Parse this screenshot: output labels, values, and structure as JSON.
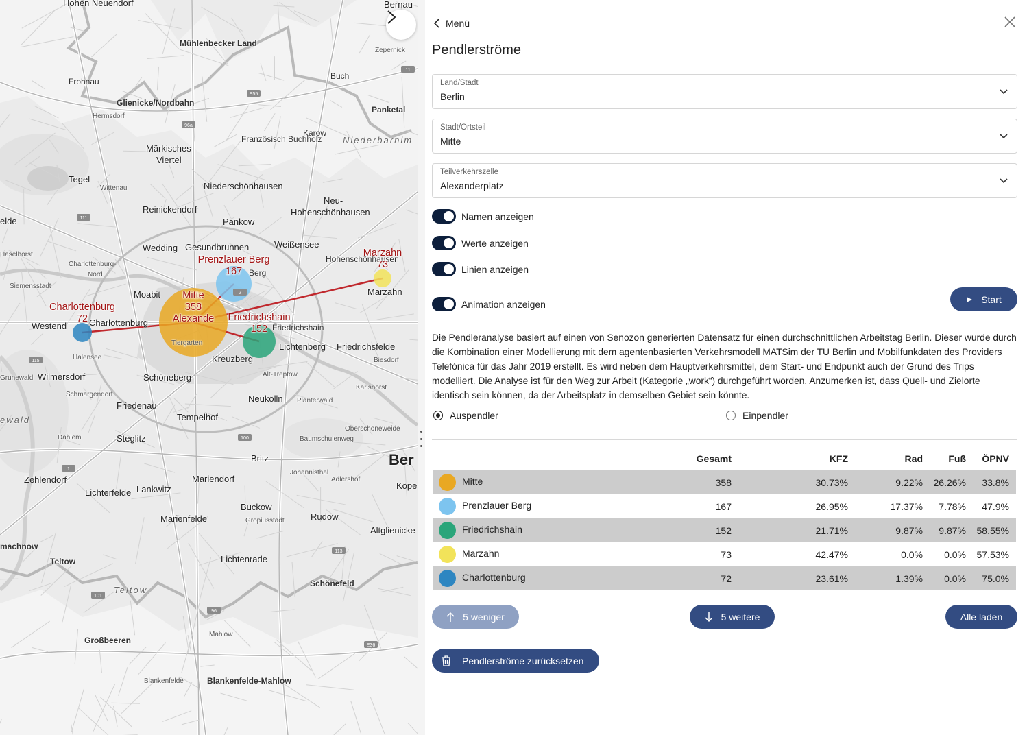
{
  "map": {
    "labels": [
      {
        "text": "Hohen Neuendorf",
        "cls": "big"
      },
      {
        "text": "Bernau",
        "cls": "big"
      },
      {
        "text": "Mühlenbecker Land",
        "cls": "bold"
      },
      {
        "text": "Zepernick",
        "cls": "tiny"
      },
      {
        "text": "Frohnau",
        "cls": ""
      },
      {
        "text": "Buch",
        "cls": ""
      },
      {
        "text": "Glienicke/Nordbahn",
        "cls": "bold"
      },
      {
        "text": "Panketal",
        "cls": "bold"
      },
      {
        "text": "Hermsdorf",
        "cls": "tiny"
      },
      {
        "text": "Französisch Buchholz",
        "cls": ""
      },
      {
        "text": "Karow",
        "cls": ""
      },
      {
        "text": "Niederbarnim",
        "cls": "italic"
      },
      {
        "text": "Märkisches",
        "cls": "big"
      },
      {
        "text": "Viertel",
        "cls": "big"
      },
      {
        "text": "Tegel",
        "cls": "big"
      },
      {
        "text": "Wittenau",
        "cls": "tiny"
      },
      {
        "text": "Niederschönhausen",
        "cls": "big"
      },
      {
        "text": "Reinickendorf",
        "cls": "big"
      },
      {
        "text": "Neu-",
        "cls": "big"
      },
      {
        "text": "Hohenschönhausen",
        "cls": "big"
      },
      {
        "text": "Pankow",
        "cls": "big"
      },
      {
        "text": "elde",
        "cls": "big"
      },
      {
        "text": "Wedding",
        "cls": "big"
      },
      {
        "text": "Gesundbrunnen",
        "cls": "big"
      },
      {
        "text": "Weißensee",
        "cls": "big"
      },
      {
        "text": "Haselhorst",
        "cls": "tiny"
      },
      {
        "text": "Charlottenburg-",
        "cls": "tiny"
      },
      {
        "text": "Nord",
        "cls": "tiny"
      },
      {
        "text": "Hohenschönhausen",
        "cls": ""
      },
      {
        "text": "Siemensstadt",
        "cls": "tiny"
      },
      {
        "text": "Moabit",
        "cls": "big"
      },
      {
        "text": "Berg",
        "cls": ""
      },
      {
        "text": "Marzahn",
        "cls": "big"
      },
      {
        "text": "Westend",
        "cls": "big"
      },
      {
        "text": "Charlottenburg",
        "cls": "big"
      },
      {
        "text": "Friedrichshain",
        "cls": ""
      },
      {
        "text": "Tiergarten",
        "cls": "tiny"
      },
      {
        "text": "Lichtenberg",
        "cls": "big"
      },
      {
        "text": "Friedrichsfelde",
        "cls": "big"
      },
      {
        "text": "Halensee",
        "cls": "tiny"
      },
      {
        "text": "Kreuzberg",
        "cls": "big"
      },
      {
        "text": "Biesdorf",
        "cls": "tiny"
      },
      {
        "text": "Grunewald",
        "cls": "tiny"
      },
      {
        "text": "Wilmersdorf",
        "cls": "big"
      },
      {
        "text": "Schöneberg",
        "cls": "big"
      },
      {
        "text": "Alt-Treptow",
        "cls": "tiny"
      },
      {
        "text": "Karlshorst",
        "cls": "tiny"
      },
      {
        "text": "Schmargendorf",
        "cls": "tiny"
      },
      {
        "text": "Neukölln",
        "cls": "big"
      },
      {
        "text": "Plänterwald",
        "cls": "tiny"
      },
      {
        "text": "Friedenau",
        "cls": "big"
      },
      {
        "text": "ewald",
        "cls": "italic"
      },
      {
        "text": "Tempelhof",
        "cls": "big"
      },
      {
        "text": "Oberschöneweide",
        "cls": "tiny"
      },
      {
        "text": "Dahlem",
        "cls": "tiny"
      },
      {
        "text": "Steglitz",
        "cls": "big"
      },
      {
        "text": "Baumschulenweg",
        "cls": "tiny"
      },
      {
        "text": "Ber",
        "cls": "huge"
      },
      {
        "text": "Britz",
        "cls": "big"
      },
      {
        "text": "Johannisthal",
        "cls": "tiny"
      },
      {
        "text": "Zehlendorf",
        "cls": "big"
      },
      {
        "text": "Mariendorf",
        "cls": "big"
      },
      {
        "text": "Adlershof",
        "cls": "tiny"
      },
      {
        "text": "Köpe",
        "cls": "big"
      },
      {
        "text": "Lankwitz",
        "cls": "big"
      },
      {
        "text": "Lichterfelde",
        "cls": "big"
      },
      {
        "text": "Buckow",
        "cls": "big"
      },
      {
        "text": "Marienfelde",
        "cls": "big"
      },
      {
        "text": "Gropiusstadt",
        "cls": "tiny"
      },
      {
        "text": "Rudow",
        "cls": "big"
      },
      {
        "text": "Altglienicke",
        "cls": "big"
      },
      {
        "text": "machnow",
        "cls": "bold"
      },
      {
        "text": "Teltow",
        "cls": "bold"
      },
      {
        "text": "Lichtenrade",
        "cls": "big"
      },
      {
        "text": "Schönefeld",
        "cls": "bold"
      },
      {
        "text": "Teltow",
        "cls": "italic"
      },
      {
        "text": "Mahlow",
        "cls": "tiny"
      },
      {
        "text": "Großbeeren",
        "cls": "bold"
      },
      {
        "text": "Blankenfelde",
        "cls": "tiny"
      },
      {
        "text": "Blankenfelde-Mahlow",
        "cls": "bold"
      }
    ],
    "road_numbers": [
      "E55",
      "96a",
      "11",
      "111",
      "115",
      "100",
      "96",
      "101",
      "113",
      "E36",
      "1",
      "2"
    ],
    "flows": [
      {
        "name": "Mitte",
        "value": 358,
        "extra": "Alexande",
        "color": "#e9a823"
      },
      {
        "name": "Prenzlauer Berg",
        "value": 167,
        "color": "#7dc4ef"
      },
      {
        "name": "Friedrichshain",
        "value": 152,
        "color": "#2aa57a"
      },
      {
        "name": "Marzahn",
        "value": 73,
        "color": "#f2e35a"
      },
      {
        "name": "Charlottenburg",
        "value": 72,
        "color": "#2e86c1"
      }
    ],
    "line_color": "#c0282d"
  },
  "panel": {
    "back_label": "Menü",
    "title": "Pendlerströme",
    "selects": [
      {
        "label": "Land/Stadt",
        "value": "Berlin"
      },
      {
        "label": "Stadt/Ortsteil",
        "value": "Mitte"
      },
      {
        "label": "Teilverkehrszelle",
        "value": "Alexanderplatz"
      }
    ],
    "toggles": [
      {
        "label": "Namen anzeigen",
        "on": true
      },
      {
        "label": "Werte anzeigen",
        "on": true
      },
      {
        "label": "Linien anzeigen",
        "on": true
      },
      {
        "label": "Animation anzeigen",
        "on": true
      }
    ],
    "start_label": "Start",
    "description": "Die Pendleranalyse basiert auf einen von Senozon generierten Datensatz für einen durchschnittlichen Arbeitstag Berlin. Dieser wurde durch die Kombination einer Modellierung mit dem agentenbasierten Verkehrsmodell MATSim der TU Berlin und Mobilfunkdaten des Providers Telefónica für das Jahr 2019 erstellt. Es wird neben dem Hauptverkehrsmittel, dem Start- und Endpunkt auch der Grund des Trips modelliert. Die Analyse ist für den Weg zur Arbeit (Kategorie „work“) durchgeführt worden. Anzumerken ist, dass Quell- und Zielorte identisch sein können, da der Arbeitsplatz in demselben Gebiet sein könnte.",
    "radio": {
      "option1": "Auspendler",
      "option2": "Einpendler",
      "selected": "Auspendler"
    },
    "table": {
      "headers": [
        "",
        "Gesamt",
        "KFZ",
        "Rad",
        "Fuß",
        "ÖPNV"
      ],
      "rows": [
        {
          "name": "Mitte",
          "color": "#e9a823",
          "gesamt": "358",
          "kfz": "30.73%",
          "rad": "9.22%",
          "fuss": "26.26%",
          "oepnv": "33.8%"
        },
        {
          "name": "Prenzlauer Berg",
          "color": "#7dc4ef",
          "gesamt": "167",
          "kfz": "26.95%",
          "rad": "17.37%",
          "fuss": "7.78%",
          "oepnv": "47.9%"
        },
        {
          "name": "Friedrichshain",
          "color": "#2aa57a",
          "gesamt": "152",
          "kfz": "21.71%",
          "rad": "9.87%",
          "fuss": "9.87%",
          "oepnv": "58.55%"
        },
        {
          "name": "Marzahn",
          "color": "#f2e35a",
          "gesamt": "73",
          "kfz": "42.47%",
          "rad": "0.0%",
          "fuss": "0.0%",
          "oepnv": "57.53%"
        },
        {
          "name": "Charlottenburg",
          "color": "#2e86c1",
          "gesamt": "72",
          "kfz": "23.61%",
          "rad": "1.39%",
          "fuss": "0.0%",
          "oepnv": "75.0%"
        }
      ]
    },
    "less_label": "5 weniger",
    "more_label": "5 weitere",
    "all_label": "Alle laden",
    "reset_label": "Pendlerströme zurücksetzen",
    "accent_color": "#334c82",
    "toggle_color": "#0d1f3c"
  }
}
